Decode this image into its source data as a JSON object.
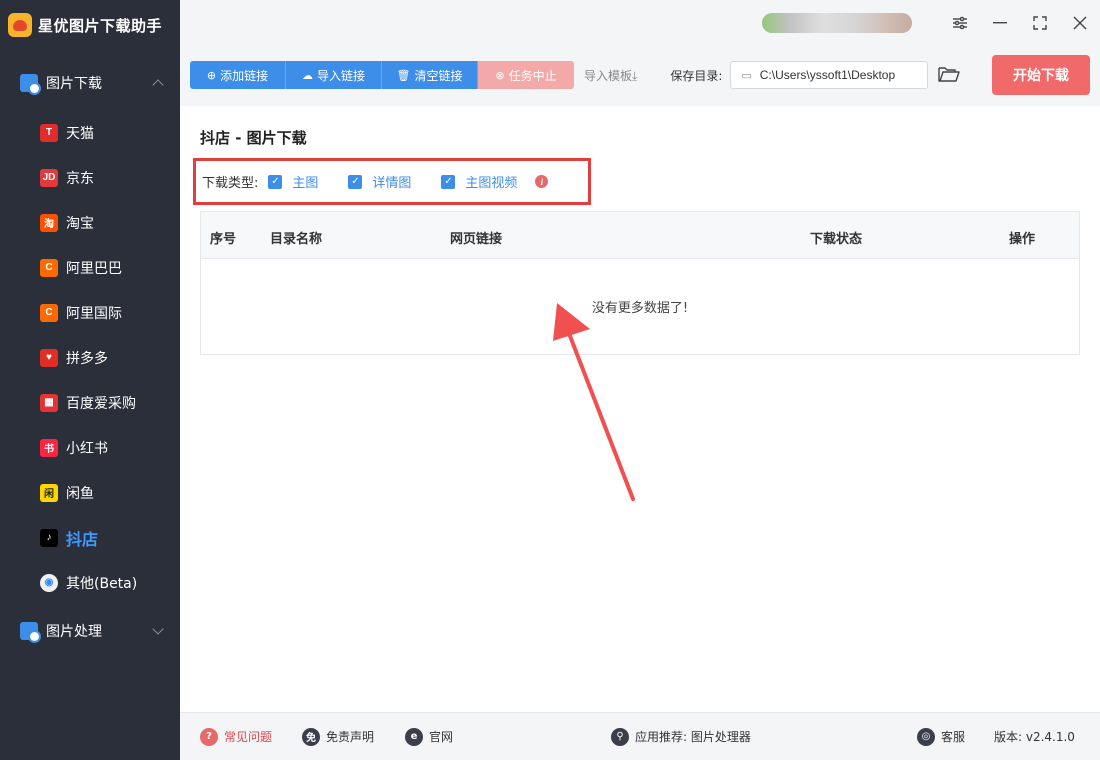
{
  "app": {
    "title": "星优图片下载助手"
  },
  "sidebar": {
    "group_download": {
      "label": "图片下载"
    },
    "items": [
      {
        "label": "天猫",
        "icon": "tmall-icon",
        "glyph": "T",
        "color": "#e22b2b"
      },
      {
        "label": "京东",
        "icon": "jd-icon",
        "glyph": "JD",
        "color": "#e4393c"
      },
      {
        "label": "淘宝",
        "icon": "taobao-icon",
        "glyph": "淘",
        "color": "#ff5000"
      },
      {
        "label": "阿里巴巴",
        "icon": "alibaba-icon",
        "glyph": "C",
        "color": "#ff6a00"
      },
      {
        "label": "阿里国际",
        "icon": "alibaba-intl-icon",
        "glyph": "C",
        "color": "#ff6a00"
      },
      {
        "label": "拼多多",
        "icon": "pinduoduo-icon",
        "glyph": "♥",
        "color": "#e02e24"
      },
      {
        "label": "百度爱采购",
        "icon": "baidu-aicaigou-icon",
        "glyph": "▦",
        "color": "#e63232"
      },
      {
        "label": "小红书",
        "icon": "xiaohongshu-icon",
        "glyph": "书",
        "color": "#ff2442"
      },
      {
        "label": "闲鱼",
        "icon": "xianyu-icon",
        "glyph": "闲",
        "color": "#ffd700"
      },
      {
        "label": "抖店",
        "icon": "douyin-icon",
        "glyph": "♪",
        "color": "#000000",
        "active": true
      },
      {
        "label": "其他(Beta)",
        "icon": "chrome-icon",
        "glyph": "◉",
        "color": "#f0f0f0"
      }
    ],
    "group_process": {
      "label": "图片处理"
    }
  },
  "toolbar": {
    "add_link": "添加链接",
    "import_link": "导入链接",
    "clear_link": "清空链接",
    "stop_task": "任务中止",
    "import_template": "导入模板⤓",
    "save_dir_label": "保存目录:",
    "save_dir_value": "C:\\Users\\yssoft1\\Desktop",
    "start_download": "开始下载"
  },
  "main": {
    "page_title": "抖店 - 图片下载",
    "download_type_label": "下载类型:",
    "checkboxes": [
      {
        "label": "主图",
        "checked": true
      },
      {
        "label": "详情图",
        "checked": true
      },
      {
        "label": "主图视频",
        "checked": true
      }
    ],
    "table": {
      "columns": [
        "序号",
        "目录名称",
        "网页链接",
        "下载状态",
        "操作"
      ],
      "empty_text": "没有更多数据了!"
    }
  },
  "footer": {
    "faq": "常见问题",
    "disclaimer": "免责声明",
    "website": "官网",
    "recommend": "应用推荐: 图片处理器",
    "service": "客服",
    "version": "版本: v2.4.1.0"
  },
  "colors": {
    "sidebar_bg": "#2b2f3a",
    "accent": "#3d8ee8",
    "start_button": "#f06a6a",
    "highlight_box": "#e33d3d"
  }
}
